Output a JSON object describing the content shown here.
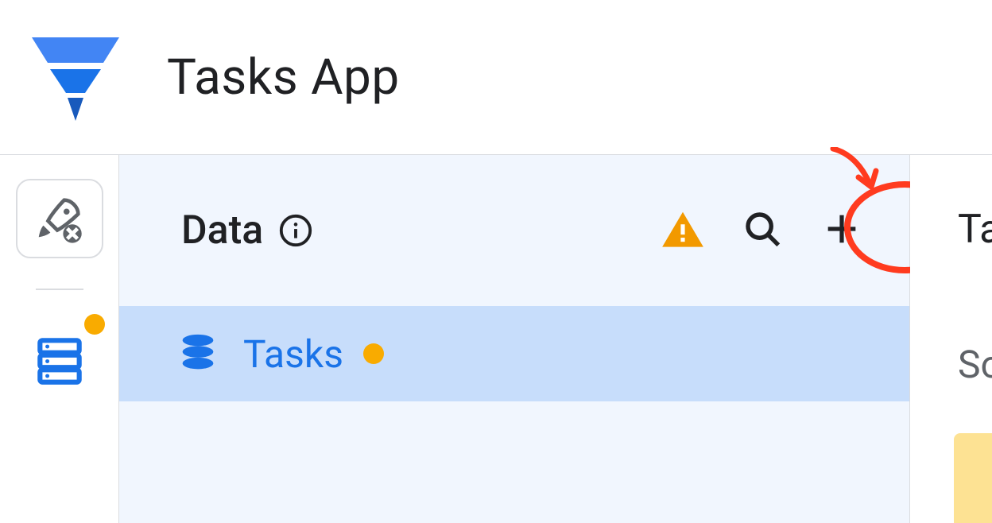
{
  "header": {
    "title": "Tasks App"
  },
  "sidebar": {
    "deploy_icon": "rocket-launch",
    "data_icon": "database"
  },
  "data_panel": {
    "title": "Data",
    "tables": [
      {
        "name": "Tasks",
        "status": "warning"
      }
    ]
  },
  "right": {
    "title_fragment": "Ta",
    "sub_fragment": "So"
  },
  "colors": {
    "brand_blue": "#1a73e8",
    "warning_amber": "#f9ab00",
    "warning_triangle": "#f29900",
    "selection_bg": "#c7ddfb",
    "panel_bg": "#f1f6fe",
    "annotation_red": "#ff3b1f"
  },
  "icons": {
    "app_logo": "appsheet-logo",
    "info": "info-outline",
    "warning": "warning-triangle",
    "search": "search",
    "add": "plus",
    "table": "stacked-disks"
  }
}
